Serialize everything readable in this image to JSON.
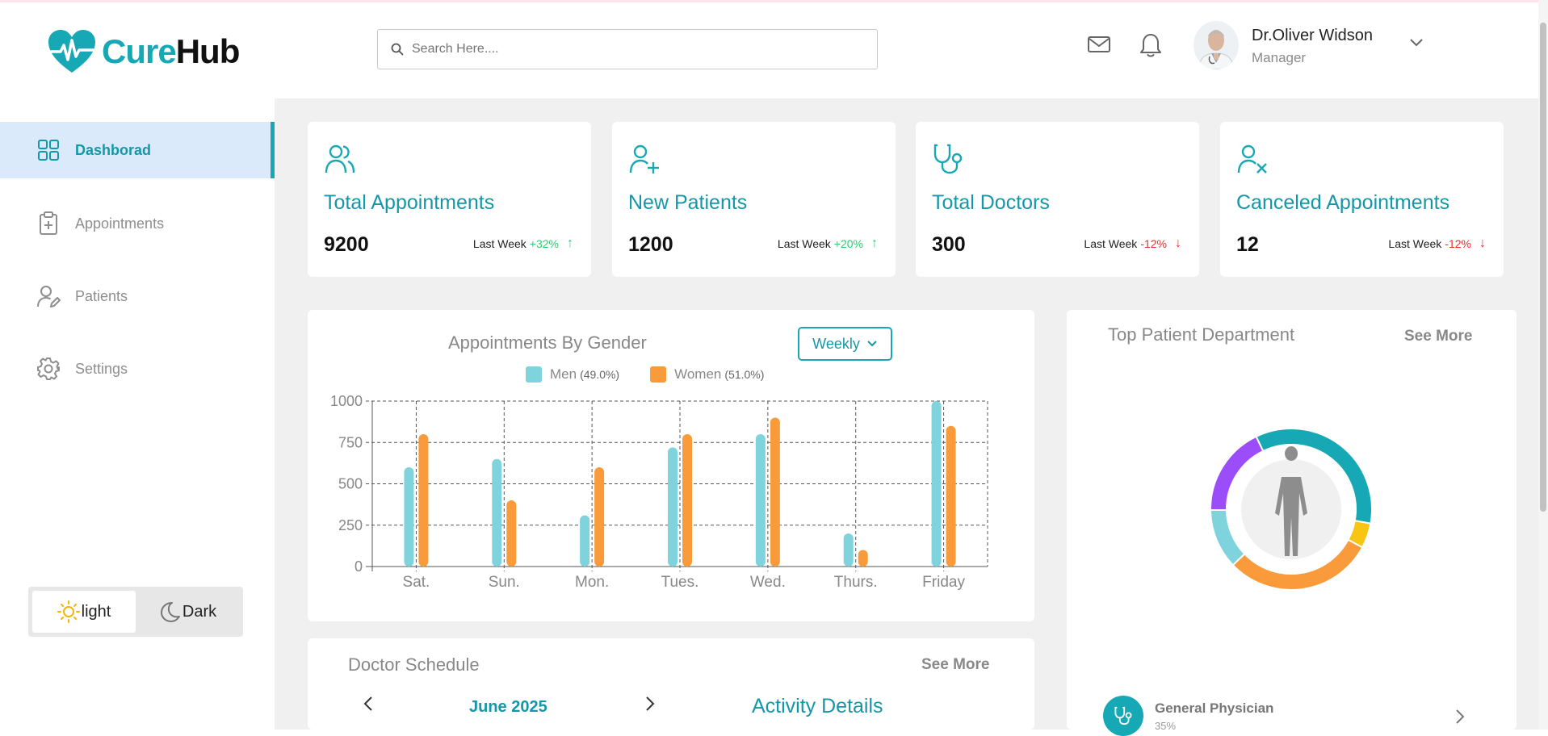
{
  "brand": {
    "name_part1": "Cure",
    "name_part2": "Hub"
  },
  "search": {
    "placeholder": "Search Here...."
  },
  "user": {
    "name": "Dr.Oliver Widson",
    "role": "Manager"
  },
  "sidebar": {
    "items": [
      {
        "label": "Dashborad",
        "icon": "grid-icon",
        "active": true
      },
      {
        "label": "Appointments",
        "icon": "clipboard-plus-icon"
      },
      {
        "label": "Patients",
        "icon": "user-edit-icon"
      },
      {
        "label": "Settings",
        "icon": "gear-icon"
      }
    ]
  },
  "theme": {
    "light_label": "light",
    "dark_label": "Dark",
    "selected": "light"
  },
  "stats": [
    {
      "title": "Total Appointments",
      "value": "9200",
      "trend_label": "Last Week",
      "trend_value": "+32%",
      "direction": "up",
      "icon": "users-icon"
    },
    {
      "title": "New Patients",
      "value": "1200",
      "trend_label": "Last Week",
      "trend_value": "+20%",
      "direction": "up",
      "icon": "user-plus-icon"
    },
    {
      "title": "Total Doctors",
      "value": "300",
      "trend_label": "Last Week",
      "trend_value": "-12%",
      "direction": "down",
      "icon": "stethoscope-icon"
    },
    {
      "title": "Canceled Appointments",
      "value": "12",
      "trend_label": "Last Week",
      "trend_value": "-12%",
      "direction": "down",
      "icon": "user-x-icon"
    }
  ],
  "appointments_chart": {
    "filter_value": "Weekly",
    "legend": [
      {
        "label": "Men",
        "pct": "(49.0%)"
      },
      {
        "label": "Women",
        "pct": "(51.0%)"
      }
    ]
  },
  "chart_data": {
    "type": "bar",
    "title": "Appointments By Gender",
    "categories": [
      "Sat.",
      "Sun.",
      "Mon.",
      "Tues.",
      "Wed.",
      "Thurs.",
      "Friday"
    ],
    "series": [
      {
        "name": "Men",
        "values": [
          600,
          650,
          310,
          720,
          800,
          200,
          1000
        ],
        "color": "#7fd3dc"
      },
      {
        "name": "Women",
        "values": [
          800,
          400,
          600,
          800,
          900,
          100,
          850
        ],
        "color": "#f99b3b"
      }
    ],
    "ylim": [
      0,
      1000
    ],
    "yticks": [
      0,
      250,
      500,
      750,
      1000
    ],
    "grid": true,
    "legend_position": "top"
  },
  "top_department": {
    "title": "Top Patient Department",
    "see_more": "See More",
    "donut": [
      {
        "value": 35,
        "color": "#16a8b4"
      },
      {
        "value": 5,
        "color": "#f9c513"
      },
      {
        "value": 30,
        "color": "#f99b3b"
      },
      {
        "value": 12,
        "color": "#7fd3dc"
      },
      {
        "value": 18,
        "color": "#9b4dfa"
      }
    ],
    "first_item": {
      "name": "General Physician",
      "pct": "35%"
    }
  },
  "schedule": {
    "title": "Doctor Schedule",
    "see_more": "See More",
    "month": "June 2025",
    "activity_title": "Activity Details"
  }
}
